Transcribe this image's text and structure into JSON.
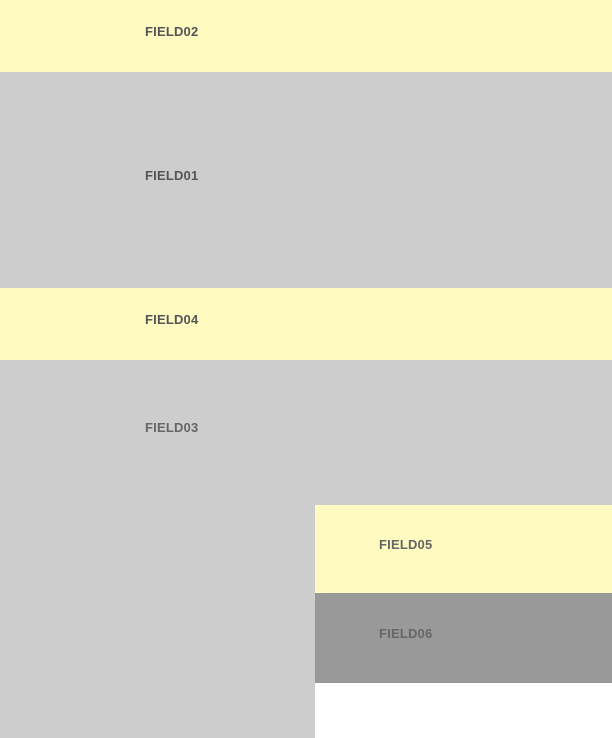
{
  "fields": {
    "field02": {
      "label": "FIELD02",
      "color": "#fffac0"
    },
    "field01": {
      "label": "FIELD01",
      "color": "#cdcdcd"
    },
    "field04": {
      "label": "FIELD04",
      "color": "#fffac0"
    },
    "field03": {
      "label": "FIELD03",
      "color": "#cdcdcd"
    },
    "field05": {
      "label": "FIELD05",
      "color": "#fffac0"
    },
    "field06": {
      "label": "FIELD06",
      "color": "#999999"
    }
  }
}
